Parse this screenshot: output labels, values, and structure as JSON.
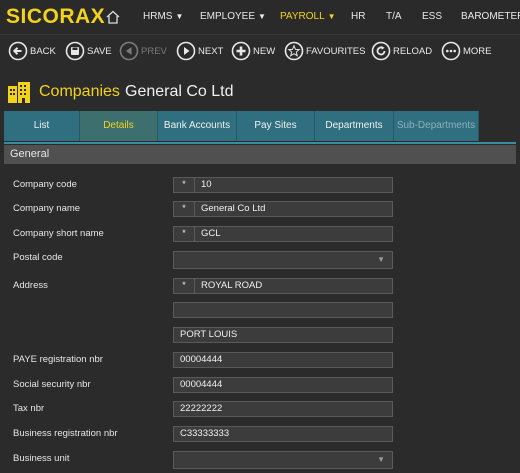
{
  "brand": "SICORAX",
  "nav": {
    "hrms": "HRMS",
    "employee": "EMPLOYEE",
    "payroll": "PAYROLL",
    "hr": "HR",
    "ta": "T/A",
    "ess": "ESS",
    "barometer": "BAROMETER"
  },
  "toolbar": {
    "back": "BACK",
    "save": "SAVE",
    "prev": "PREV",
    "next": "NEXT",
    "new": "NEW",
    "favourites": "FAVOURITES",
    "reload": "RELOAD",
    "more": "MORE"
  },
  "title": {
    "module": "Companies",
    "record": "General Co Ltd"
  },
  "tabs": {
    "list": "List",
    "details": "Details",
    "bank_accounts": "Bank Accounts",
    "pay_sites": "Pay Sites",
    "departments": "Departments",
    "sub_departments": "Sub-Departments"
  },
  "section": "General",
  "form": {
    "company_code": {
      "label": "Company code",
      "value": "10",
      "required": "*"
    },
    "company_name": {
      "label": "Company name",
      "value": "General Co Ltd",
      "required": "*"
    },
    "company_short_name": {
      "label": "Company short name",
      "value": "GCL",
      "required": "*"
    },
    "postal_code": {
      "label": "Postal code",
      "value": ""
    },
    "address": {
      "label": "Address",
      "line1": "ROYAL ROAD",
      "line2": "",
      "line3": "PORT LOUIS",
      "required": "*"
    },
    "paye_registration_nbr": {
      "label": "PAYE registration nbr",
      "value": "00004444"
    },
    "social_security_nbr": {
      "label": "Social security nbr",
      "value": "00004444"
    },
    "tax_nbr": {
      "label": "Tax nbr",
      "value": "22222222"
    },
    "business_registration_nbr": {
      "label": "Business registration nbr",
      "value": "C33333333"
    },
    "business_unit": {
      "label": "Business unit",
      "value": ""
    }
  },
  "colors": {
    "accent": "#f2d21b",
    "tab_bg": "#2f6f7f",
    "tab_active_bg": "#3d6f6f",
    "background": "#2b2b2b"
  }
}
